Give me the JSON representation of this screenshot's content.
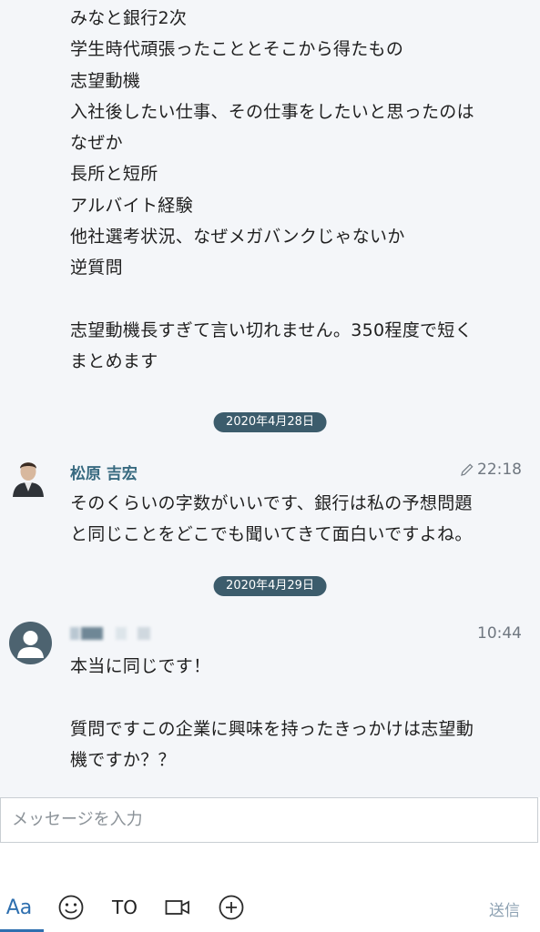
{
  "messages": {
    "first": {
      "text": "みなと銀行2次\n学生時代頑張ったこととそこから得たもの\n志望動機\n入社後したい仕事、その仕事をしたいと思ったのは\nなぜか\n長所と短所\nアルバイト経験\n他社選考状況、なぜメガバンクじゃないか\n逆質問\n\n志望動機長すぎて言い切れません。350程度で短く\nまとめます"
    },
    "date1": "2020年4月28日",
    "second": {
      "sender": "松原 吉宏",
      "time": "22:18",
      "text": "そのくらいの字数がいいです、銀行は私の予想問題\nと同じことをどこでも聞いてきて面白いですよね。"
    },
    "date2": "2020年4月29日",
    "third": {
      "time": "10:44",
      "text": "本当に同じです！\n\n質問ですこの企業に興味を持ったきっかけは志望動\n機ですか？？"
    }
  },
  "input": {
    "placeholder": "メッセージを入力"
  },
  "toolbar": {
    "aa_label": "Aa",
    "to_label": "TO",
    "send_label": "送信"
  },
  "colors": {
    "accent": "#2e6faf",
    "sender_name": "#386a80",
    "date_pill": "#3c5c6c",
    "background": "#f4f6f9"
  }
}
